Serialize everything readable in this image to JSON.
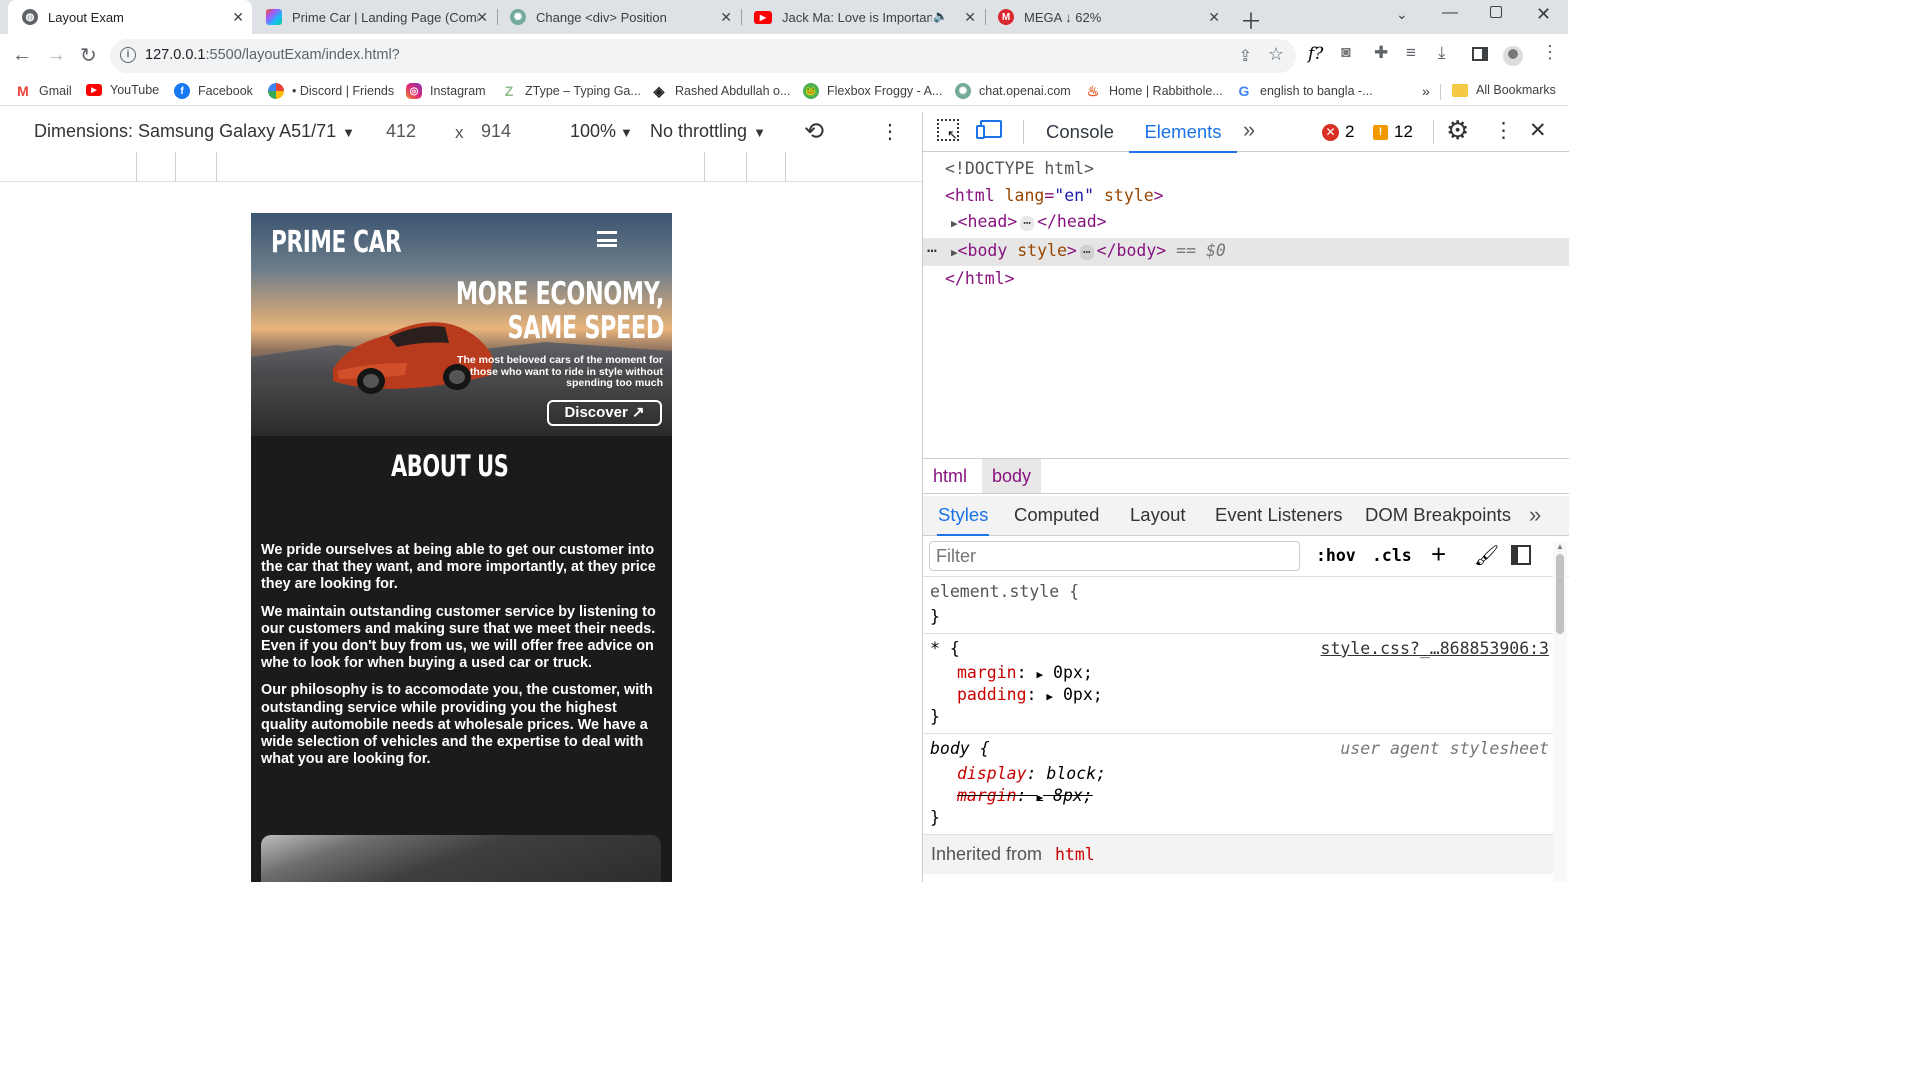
{
  "tabs": [
    {
      "title": "Layout Exam",
      "active": true,
      "icon": "globe-icon"
    },
    {
      "title": "Prime Car | Landing Page (Comm",
      "active": false,
      "icon": "figma-icon"
    },
    {
      "title": "Change <div> Position",
      "active": false,
      "icon": "openai-icon"
    },
    {
      "title": "Jack Ma: Love is Important Ir",
      "active": false,
      "icon": "youtube-icon"
    },
    {
      "title": "MEGA ↓ 62%",
      "active": false,
      "icon": "mega-icon"
    }
  ],
  "address": {
    "host": "127.0.0.1",
    "rest": ":5500/layoutExam/index.html?"
  },
  "bookmarks": [
    {
      "label": "Gmail",
      "icon": "gmail-icon"
    },
    {
      "label": "YouTube",
      "icon": "youtube-icon"
    },
    {
      "label": "Facebook",
      "icon": "facebook-icon"
    },
    {
      "label": "• Discord | Friends",
      "icon": "discord-icon"
    },
    {
      "label": "Instagram",
      "icon": "instagram-icon"
    },
    {
      "label": "ZType – Typing Ga...",
      "icon": "ztype-icon"
    },
    {
      "label": "Rashed Abdullah o...",
      "icon": "github-icon"
    },
    {
      "label": "Flexbox Froggy - A...",
      "icon": "frog-icon"
    },
    {
      "label": "chat.openai.com",
      "icon": "openai-icon"
    },
    {
      "label": "Home | Rabbithole...",
      "icon": "rabbithole-icon"
    },
    {
      "label": "english to bangla -...",
      "icon": "google-icon"
    }
  ],
  "all_bookmarks": "All Bookmarks",
  "device": {
    "dimensions": "Dimensions: Samsung Galaxy A51/71",
    "width": "412",
    "times": "x",
    "height": "914",
    "zoom": "100%",
    "throttling": "No throttling"
  },
  "site": {
    "logo": "PRIME CAR",
    "headline1": "MORE ECONOMY,",
    "headline2": "SAME SPEED",
    "sub1": "The most beloved cars of the moment for",
    "sub2": "those who want to ride in style without",
    "sub3": "spending too much",
    "cta": "Discover ↗",
    "about_title": "ABOUT US",
    "p1": "We pride ourselves at being able to get our customer into the car that they want, and more importantly, at they price they are looking for.",
    "p2": "We maintain outstanding customer service by listening to our customers and making sure that we meet their needs. Even if you don't buy from us, we will offer free advice on whe to look for when buying a used car or truck.",
    "p3": "Our philosophy is to accomodate you, the customer, with outstanding service while providing you the highest quality automobile needs at wholesale prices. We have a wide selection of vehicles and the expertise to deal with what you are looking for."
  },
  "devtools": {
    "tabs": [
      "Console",
      "Elements"
    ],
    "active_tab": "Elements",
    "errors": "2",
    "warnings": "12",
    "dom": {
      "doctype": "<!DOCTYPE html>",
      "html_open_tag": "<html",
      "html_attr": "lang",
      "html_attr_eq": "=",
      "html_attr_val": "\"en\"",
      "html_style": "style",
      "html_close": ">",
      "head_open": "<head>",
      "head_close": "</head>",
      "body_open": "<body",
      "body_style": "style",
      "body_close": "</body>",
      "selected_marker": "== $0",
      "html_end": "</html>",
      "ellipsis": "⋯"
    },
    "breadcrumbs": [
      "html",
      "body"
    ],
    "subtabs": [
      "Styles",
      "Computed",
      "Layout",
      "Event Listeners",
      "DOM Breakpoints"
    ],
    "filter_placeholder": "Filter",
    "hov": ":hov",
    "cls": ".cls",
    "rules": {
      "element_style": "element.style {",
      "close": "}",
      "universal": "* {",
      "universal_source": "style.css?_…868853906:3",
      "margin": "margin",
      "padding": "padding",
      "zero": "0px;",
      "body_sel": "body {",
      "user_agent": "user agent stylesheet",
      "display": "display",
      "block": "block;",
      "body_margin_val": "8px;",
      "inherited": "Inherited from",
      "inherited_tag": "html"
    }
  }
}
